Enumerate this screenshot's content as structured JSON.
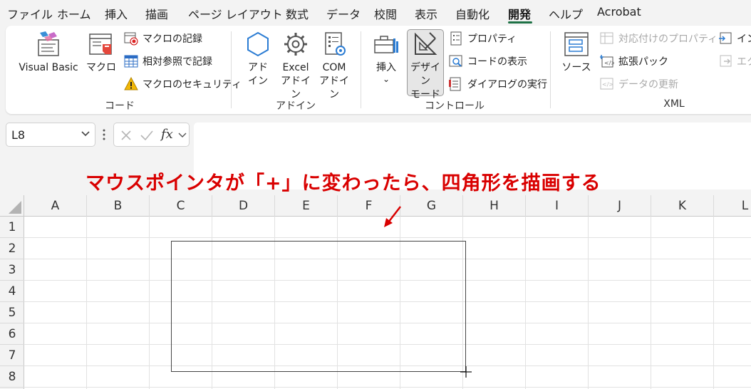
{
  "tabs": [
    "ファイル",
    "ホーム",
    "挿入",
    "描画",
    "ページ レイアウト",
    "数式",
    "データ",
    "校閲",
    "表示",
    "自動化",
    "開発",
    "ヘルプ",
    "Acrobat"
  ],
  "active_tab": "開発",
  "ribbon": {
    "code": {
      "label": "コード",
      "visual_basic": "Visual Basic",
      "macro": "マクロ",
      "record_macro": "マクロの記録",
      "relative_ref": "相対参照で記録",
      "macro_security": "マクロのセキュリティ"
    },
    "addins": {
      "label": "アドイン",
      "addin_line1": "アド",
      "addin_line2": "イン",
      "excel_line1": "Excel",
      "excel_line2": "アドイン",
      "com_line1": "COM",
      "com_line2": "アドイン"
    },
    "controls": {
      "label": "コントロール",
      "insert": "挿入",
      "design_line1": "デザイン",
      "design_line2": "モード",
      "properties": "プロパティ",
      "view_code": "コードの表示",
      "run_dialog": "ダイアログの実行"
    },
    "xml": {
      "label": "XML",
      "source": "ソース",
      "map_properties": "対応付けのプロパティ",
      "expansion_packs": "拡張パック",
      "refresh_data": "データの更新",
      "import_partial": "イン",
      "export_partial": "エク"
    }
  },
  "formula_bar": {
    "name_box": "L8",
    "fx": "fx",
    "formula": ""
  },
  "annotation": "マウスポインタが「+」に変わったら、四角形を描画する",
  "columns": [
    "A",
    "B",
    "C",
    "D",
    "E",
    "F",
    "G",
    "H",
    "I",
    "J",
    "K",
    "L"
  ],
  "rows": [
    "1",
    "2",
    "3",
    "4",
    "5",
    "6",
    "7",
    "8"
  ],
  "colors": {
    "annotation": "#d90000",
    "active_tab_underline": "#1e7145",
    "ribbon_bg": "#ffffff",
    "app_bg": "#f3f3f3"
  }
}
